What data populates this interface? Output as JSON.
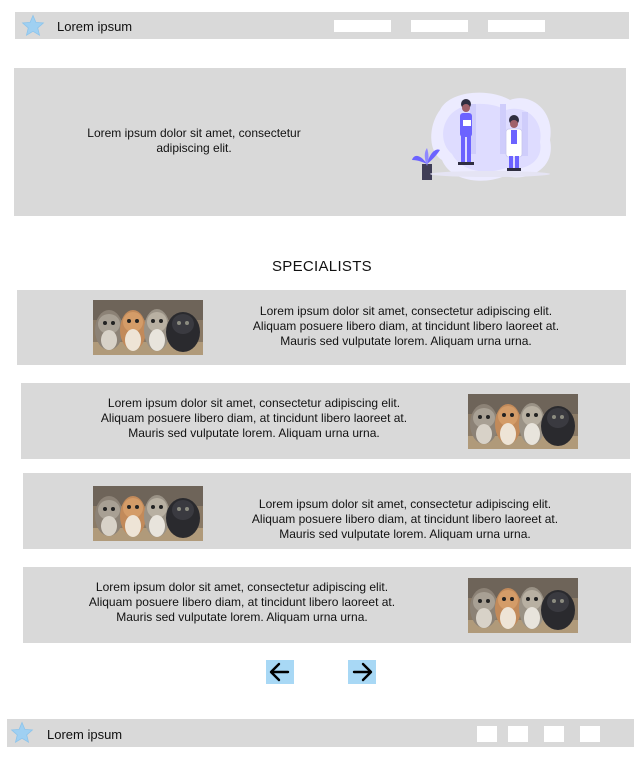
{
  "header": {
    "brand": "Lorem ipsum",
    "logo_icon": "star-icon",
    "nav_items": [
      "",
      "",
      ""
    ]
  },
  "hero": {
    "text": "Lorem ipsum dolor sit amet, consectetur adipiscing elit.",
    "illustration": "doctors-illustration"
  },
  "specialists": {
    "title": "SPECIALISTS",
    "cards": [
      {
        "text": "Lorem ipsum dolor sit amet, consectetur adipiscing elit. Aliquam posuere libero diam, at tincidunt libero laoreet at. Mauris sed vulputate lorem. Aliquam urna urna.",
        "image": "kittens-photo",
        "image_side": "left"
      },
      {
        "text": "Lorem ipsum dolor sit amet, consectetur adipiscing elit. Aliquam posuere libero diam, at tincidunt libero laoreet at. Mauris sed vulputate lorem. Aliquam urna urna.",
        "image": "kittens-photo",
        "image_side": "right"
      },
      {
        "text": "Lorem ipsum dolor sit amet, consectetur adipiscing elit. Aliquam posuere libero diam, at tincidunt libero laoreet at. Mauris sed vulputate lorem. Aliquam urna urna.",
        "image": "kittens-photo",
        "image_side": "left"
      },
      {
        "text": "Lorem ipsum dolor sit amet, consectetur adipiscing elit. Aliquam posuere libero diam, at tincidunt libero laoreet at. Mauris sed vulputate lorem. Aliquam urna urna.",
        "image": "kittens-photo",
        "image_side": "right"
      }
    ]
  },
  "pagination": {
    "prev_icon": "arrow-left-icon",
    "next_icon": "arrow-right-icon"
  },
  "footer": {
    "brand": "Lorem ipsum",
    "logo_icon": "star-icon",
    "nav_items": [
      "",
      "",
      "",
      ""
    ]
  },
  "colors": {
    "panel": "#d9d9d9",
    "accent_blue": "#a8d8f5",
    "star": "#9fd0f2",
    "illustration_purple": "#6c63ff"
  }
}
